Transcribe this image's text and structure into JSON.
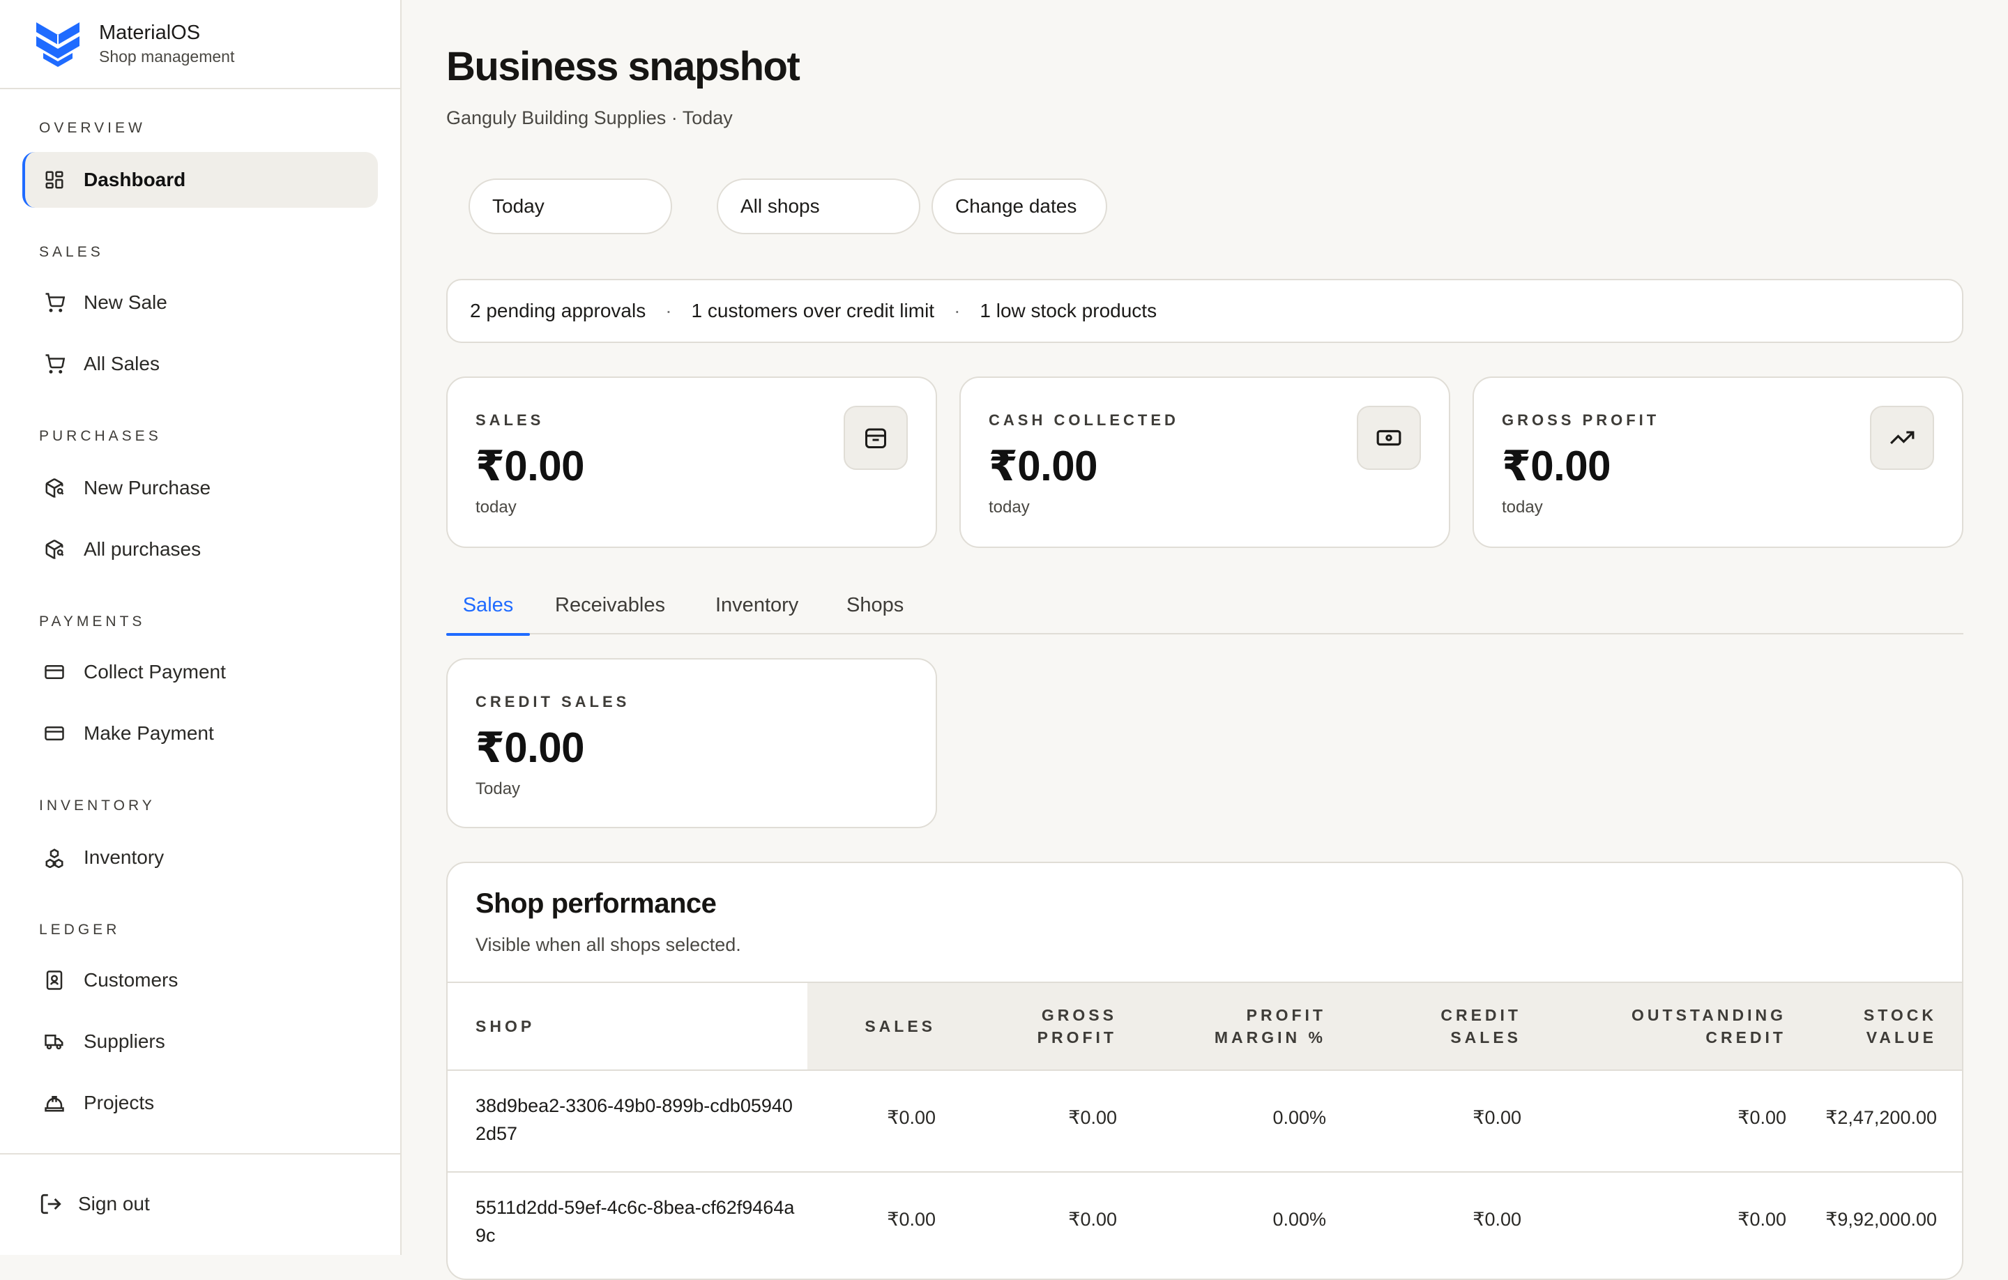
{
  "brand": {
    "name": "MaterialOS",
    "subtitle": "Shop management"
  },
  "nav": {
    "sections": [
      {
        "label": "Overview",
        "items": [
          {
            "label": "Dashboard",
            "icon": "dashboard-icon",
            "active": true
          }
        ]
      },
      {
        "label": "Sales",
        "items": [
          {
            "label": "New Sale",
            "icon": "cart-icon"
          },
          {
            "label": "All Sales",
            "icon": "cart-icon"
          }
        ]
      },
      {
        "label": "Purchases",
        "items": [
          {
            "label": "New Purchase",
            "icon": "package-search-icon"
          },
          {
            "label": "All purchases",
            "icon": "package-search-icon"
          }
        ]
      },
      {
        "label": "Payments",
        "items": [
          {
            "label": "Collect Payment",
            "icon": "credit-card-icon"
          },
          {
            "label": "Make Payment",
            "icon": "credit-card-icon"
          }
        ]
      },
      {
        "label": "Inventory",
        "items": [
          {
            "label": "Inventory",
            "icon": "boxes-icon"
          }
        ]
      },
      {
        "label": "Ledger",
        "items": [
          {
            "label": "Customers",
            "icon": "contact-book-icon"
          },
          {
            "label": "Suppliers",
            "icon": "truck-icon"
          },
          {
            "label": "Projects",
            "icon": "hard-hat-icon"
          }
        ]
      }
    ],
    "sign_out": "Sign out"
  },
  "header": {
    "title": "Business snapshot",
    "subtitle": "Ganguly Building Supplies · Today"
  },
  "filters": {
    "period": "Today",
    "shop": "All shops",
    "change_dates": "Change dates"
  },
  "alerts": {
    "items": [
      "2 pending approvals",
      "1 customers over credit limit",
      "1 low stock products"
    ],
    "separator": "·"
  },
  "metrics": [
    {
      "label": "Sales",
      "value": "₹0.00",
      "note": "today",
      "icon": "shopping-bag-icon"
    },
    {
      "label": "Cash collected",
      "value": "₹0.00",
      "note": "today",
      "icon": "banknote-icon"
    },
    {
      "label": "Gross profit",
      "value": "₹0.00",
      "note": "today",
      "icon": "trending-up-icon"
    }
  ],
  "tabs": [
    "Sales",
    "Receivables",
    "Inventory",
    "Shops"
  ],
  "credit_sales": {
    "label": "Credit sales",
    "value": "₹0.00",
    "note": "Today"
  },
  "performance": {
    "title": "Shop performance",
    "subtitle": "Visible when all shops selected.",
    "columns": [
      "Shop",
      "Sales",
      "Gross profit",
      "Profit margin %",
      "Credit sales",
      "Outstanding credit",
      "Stock value"
    ],
    "rows": [
      {
        "shop": "38d9bea2-3306-49b0-899b-cdb059402d57",
        "sales": "₹0.00",
        "gross_profit": "₹0.00",
        "margin": "0.00%",
        "credit_sales": "₹0.00",
        "outstanding": "₹0.00",
        "stock_value": "₹2,47,200.00"
      },
      {
        "shop": "5511d2dd-59ef-4c6c-8bea-cf62f9464a9c",
        "sales": "₹0.00",
        "gross_profit": "₹0.00",
        "margin": "0.00%",
        "credit_sales": "₹0.00",
        "outstanding": "₹0.00",
        "stock_value": "₹9,92,000.00"
      }
    ]
  },
  "colors": {
    "accent": "#1f6bff",
    "background": "#f8f7f4",
    "border": "#e0ddd6",
    "muted_fill": "#f0eee9"
  }
}
